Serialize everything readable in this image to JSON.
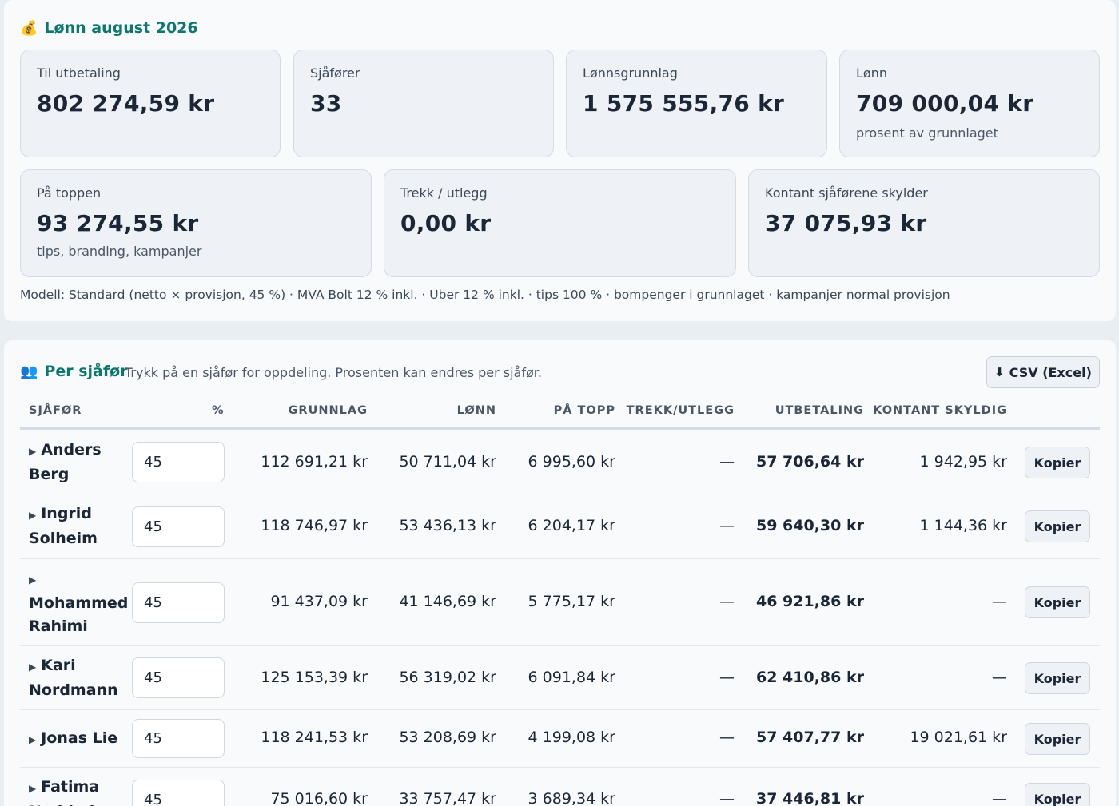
{
  "summary": {
    "title": "Lønn august 2026",
    "title_icon": "money-bag-icon",
    "cards_row1": [
      {
        "label": "Til utbetaling",
        "value": "802 274,59 kr",
        "note": ""
      },
      {
        "label": "Sjåfører",
        "value": "33",
        "note": ""
      },
      {
        "label": "Lønnsgrunnlag",
        "value": "1 575 555,76 kr",
        "note": ""
      },
      {
        "label": "Lønn",
        "value": "709 000,04 kr",
        "note": "prosent av grunnlaget"
      }
    ],
    "cards_row2": [
      {
        "label": "På toppen",
        "value": "93 274,55 kr",
        "note": "tips, branding, kampanjer"
      },
      {
        "label": "Trekk / utlegg",
        "value": "0,00 kr",
        "note": ""
      },
      {
        "label": "Kontant sjåførene skylder",
        "value": "37 075,93 kr",
        "note": ""
      }
    ],
    "model_line": "Modell: Standard (netto × provisjon, 45 %) · MVA Bolt 12 % inkl. · Uber 12 % inkl. · tips 100 % · bompenger i grunnlaget · kampanjer normal provisjon"
  },
  "drivers": {
    "title": "Per sjåfør",
    "title_icon": "people-icon",
    "hint": "Trykk på en sjåfør for oppdeling. Prosenten kan endres per sjåfør.",
    "csv_label": "CSV (Excel)",
    "csv_icon": "download-arrow-icon",
    "columns": {
      "driver": "SJÅFØR",
      "pct": "%",
      "base": "GRUNNLAG",
      "wage": "LØNN",
      "top": "PÅ TOPP",
      "deduct": "TREKK/UTLEGG",
      "payout": "UTBETALING",
      "cash": "KONTANT SKYLDIG"
    },
    "copy_label": "Kopier",
    "caret": "▶",
    "rows": [
      {
        "name": "Anders Berg",
        "pct": "45",
        "base": "112 691,21 kr",
        "wage": "50 711,04 kr",
        "top": "6 995,60 kr",
        "deduct": "—",
        "payout": "57 706,64 kr",
        "cash": "1 942,95 kr"
      },
      {
        "name": "Ingrid Solheim",
        "pct": "45",
        "base": "118 746,97 kr",
        "wage": "53 436,13 kr",
        "top": "6 204,17 kr",
        "deduct": "—",
        "payout": "59 640,30 kr",
        "cash": "1 144,36 kr"
      },
      {
        "name": "Mohammed Rahimi",
        "pct": "45",
        "base": "91 437,09 kr",
        "wage": "41 146,69 kr",
        "top": "5 775,17 kr",
        "deduct": "—",
        "payout": "46 921,86 kr",
        "cash": "—"
      },
      {
        "name": "Kari Nordmann",
        "pct": "45",
        "base": "125 153,39 kr",
        "wage": "56 319,02 kr",
        "top": "6 091,84 kr",
        "deduct": "—",
        "payout": "62 410,86 kr",
        "cash": "—"
      },
      {
        "name": "Jonas Lie",
        "pct": "45",
        "base": "118 241,53 kr",
        "wage": "53 208,69 kr",
        "top": "4 199,08 kr",
        "deduct": "—",
        "payout": "57 407,77 kr",
        "cash": "19 021,61 kr"
      },
      {
        "name": "Fatima Haddad",
        "pct": "45",
        "base": "75 016,60 kr",
        "wage": "33 757,47 kr",
        "top": "3 689,34 kr",
        "deduct": "—",
        "payout": "37 446,81 kr",
        "cash": "—"
      }
    ]
  }
}
